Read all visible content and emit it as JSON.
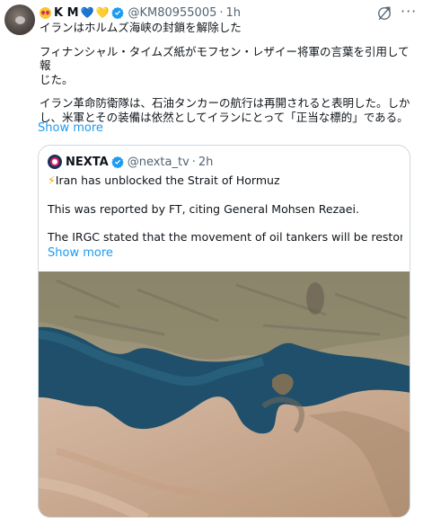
{
  "author": {
    "display_name": "K M",
    "handle": "@KM80955005",
    "separator": "·",
    "time": "1h"
  },
  "tweet": {
    "paragraphs": [
      [
        "イランはホルムズ海峡の封鎖を解除した"
      ],
      [
        "フィナンシャル・タイムズ紙がモフセン・レザイー将軍の言葉を引用して報",
        "じた。"
      ],
      [
        "イラン革命防衛隊は、石油タンカーの航行は再開されると表明した。しか",
        "し、米軍とその装備は依然としてイランにとって「正当な標的」である。"
      ]
    ],
    "show_more": "Show more"
  },
  "quoted": {
    "display_name": "NEXTA",
    "handle": "@nexta_tv",
    "separator": "·",
    "time": "2h",
    "headline_icon": "⚡",
    "headline": "Iran has unblocked the Strait of Hormuz",
    "line2": "This was reported by FT, citing General Mohsen Rezaei.",
    "line3": "The IRGC stated that the movement of oil tankers will be restored — ...",
    "show_more": "Show more"
  },
  "icons": {
    "hearts": [
      "💙",
      "💛"
    ],
    "more": "···"
  },
  "colors": {
    "link": "#1d9bf0",
    "muted": "#536471",
    "verified": "#1d9bf0",
    "border": "#cfd9de"
  }
}
